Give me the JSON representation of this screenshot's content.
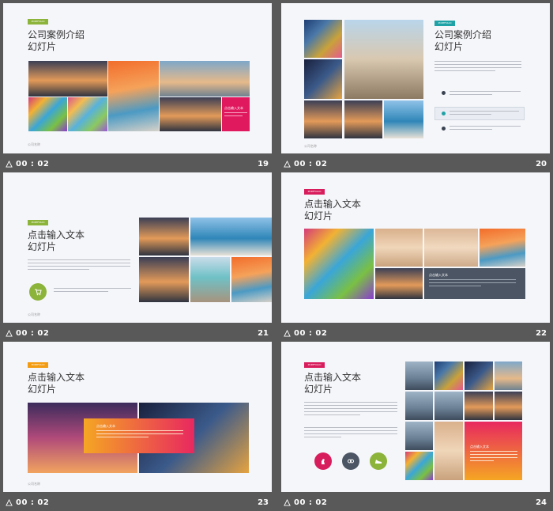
{
  "colors": {
    "tag_green": "#8cb33a",
    "tag_teal": "#1fa2a6",
    "tag_pink": "#d81d5c",
    "tag_orange": "#f39c12",
    "dark_panel": "#4b5563",
    "accent_green": "#8cb33a"
  },
  "slides": [
    {
      "number": "19",
      "time": "00 : 02",
      "tag": "PORTFOLIO",
      "title": [
        "公司案例介绍",
        "幻灯片"
      ],
      "overlay_text": "点击输入文本",
      "footer": "公司名称"
    },
    {
      "number": "20",
      "time": "00 : 02",
      "tag": "PORTFOLIO",
      "title": [
        "公司案例介绍",
        "幻灯片"
      ],
      "footer": "公司名称",
      "list_icon": "check-circle-icon"
    },
    {
      "number": "21",
      "time": "00 : 02",
      "tag": "PORTFOLIO",
      "title": [
        "点击输入文本",
        "幻灯片"
      ],
      "footer": "公司名称",
      "icon": "cart-icon"
    },
    {
      "number": "22",
      "time": "00 : 02",
      "tag": "PORTFOLIO",
      "title": [
        "点击输入文本",
        "幻灯片"
      ],
      "overlay_text": "点击输入文本",
      "footer": ""
    },
    {
      "number": "23",
      "time": "00 : 02",
      "tag": "PORTFOLIO",
      "title": [
        "点击输入文本",
        "幻灯片"
      ],
      "overlay_text": "点击输入文本",
      "footer": "公司名称"
    },
    {
      "number": "24",
      "time": "00 : 02",
      "tag": "PORTFOLIO",
      "title": [
        "点击输入文本",
        "幻灯片"
      ],
      "overlay_text": "点击输入文本",
      "footer": "",
      "icons": [
        "horse-icon",
        "link-icon",
        "shoe-icon"
      ]
    }
  ]
}
